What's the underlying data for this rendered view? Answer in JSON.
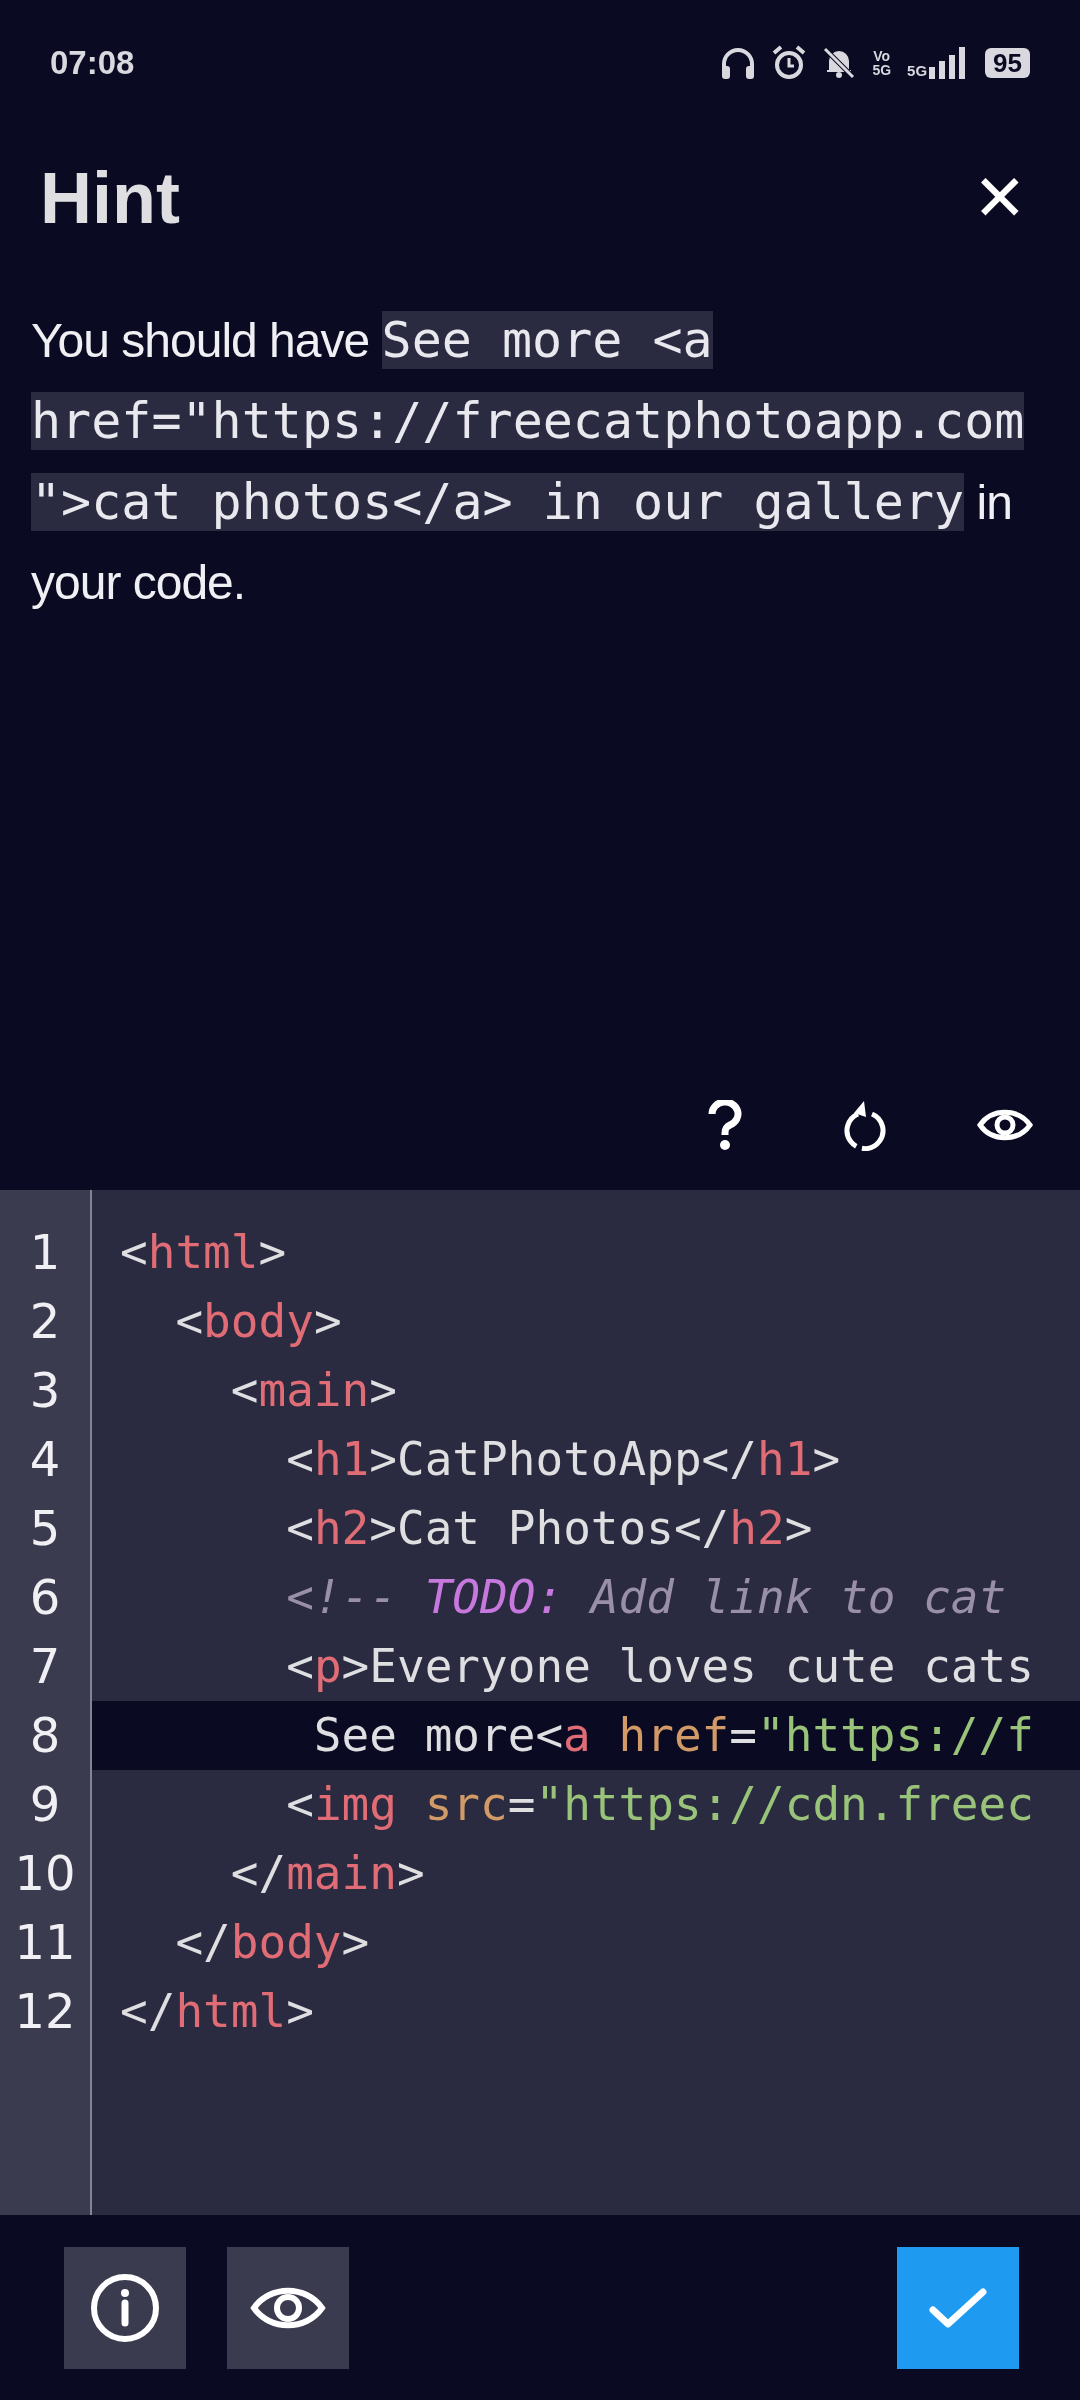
{
  "status_bar": {
    "time": "07:08",
    "volte_top": "Vo",
    "volte_bottom": "5G",
    "network": "5G",
    "battery": "95"
  },
  "hint": {
    "title": "Hint",
    "close": "✕",
    "parts": [
      {
        "kind": "text",
        "text": "You should have "
      },
      {
        "kind": "code",
        "text": "See more <a href=\"https://freecatphotoapp.com\">cat photos</a> in our gallery"
      },
      {
        "kind": "text",
        "text": " in your code."
      }
    ]
  },
  "editor": {
    "lines": [
      {
        "number": "1",
        "selected": false,
        "tokens": [
          {
            "kind": "punct",
            "text": "<"
          },
          {
            "kind": "tag",
            "text": "html"
          },
          {
            "kind": "punct",
            "text": ">"
          }
        ]
      },
      {
        "number": "2",
        "selected": false,
        "tokens": [
          {
            "kind": "punct",
            "text": "  <"
          },
          {
            "kind": "tag",
            "text": "body"
          },
          {
            "kind": "punct",
            "text": ">"
          }
        ]
      },
      {
        "number": "3",
        "selected": false,
        "tokens": [
          {
            "kind": "punct",
            "text": "    <"
          },
          {
            "kind": "tag",
            "text": "main"
          },
          {
            "kind": "punct",
            "text": ">"
          }
        ]
      },
      {
        "number": "4",
        "selected": false,
        "tokens": [
          {
            "kind": "punct",
            "text": "      <"
          },
          {
            "kind": "tag",
            "text": "h1"
          },
          {
            "kind": "punct",
            "text": ">CatPhotoApp</"
          },
          {
            "kind": "tag",
            "text": "h1"
          },
          {
            "kind": "punct",
            "text": ">"
          }
        ]
      },
      {
        "number": "5",
        "selected": false,
        "tokens": [
          {
            "kind": "punct",
            "text": "      <"
          },
          {
            "kind": "tag",
            "text": "h2"
          },
          {
            "kind": "punct",
            "text": ">Cat Photos</"
          },
          {
            "kind": "tag",
            "text": "h2"
          },
          {
            "kind": "punct",
            "text": ">"
          }
        ]
      },
      {
        "number": "6",
        "selected": false,
        "tokens": [
          {
            "kind": "comment",
            "text": "      <!-- "
          },
          {
            "kind": "keyword",
            "text": "TODO:"
          },
          {
            "kind": "comment",
            "text": " Add link to cat"
          }
        ]
      },
      {
        "number": "7",
        "selected": false,
        "tokens": [
          {
            "kind": "punct",
            "text": "      <"
          },
          {
            "kind": "tag",
            "text": "p"
          },
          {
            "kind": "punct",
            "text": ">Everyone loves cute cats"
          }
        ]
      },
      {
        "number": "8",
        "selected": true,
        "tokens": [
          {
            "kind": "punct",
            "text": "       See more<"
          },
          {
            "kind": "tag",
            "text": "a"
          },
          {
            "kind": "attr",
            "text": " href"
          },
          {
            "kind": "punct",
            "text": "="
          },
          {
            "kind": "string",
            "text": "\"https://f"
          }
        ]
      },
      {
        "number": "9",
        "selected": false,
        "tokens": [
          {
            "kind": "punct",
            "text": "      <"
          },
          {
            "kind": "tag",
            "text": "img"
          },
          {
            "kind": "attr",
            "text": " src"
          },
          {
            "kind": "punct",
            "text": "="
          },
          {
            "kind": "string",
            "text": "\"https://cdn.freec"
          }
        ]
      },
      {
        "number": "10",
        "selected": false,
        "tokens": [
          {
            "kind": "punct",
            "text": "    </"
          },
          {
            "kind": "tag",
            "text": "main"
          },
          {
            "kind": "punct",
            "text": ">"
          }
        ]
      },
      {
        "number": "11",
        "selected": false,
        "tokens": [
          {
            "kind": "punct",
            "text": "  </"
          },
          {
            "kind": "tag",
            "text": "body"
          },
          {
            "kind": "punct",
            "text": ">"
          }
        ]
      },
      {
        "number": "12",
        "selected": false,
        "tokens": [
          {
            "kind": "punct",
            "text": "</"
          },
          {
            "kind": "tag",
            "text": "html"
          },
          {
            "kind": "punct",
            "text": ">"
          }
        ]
      }
    ]
  }
}
